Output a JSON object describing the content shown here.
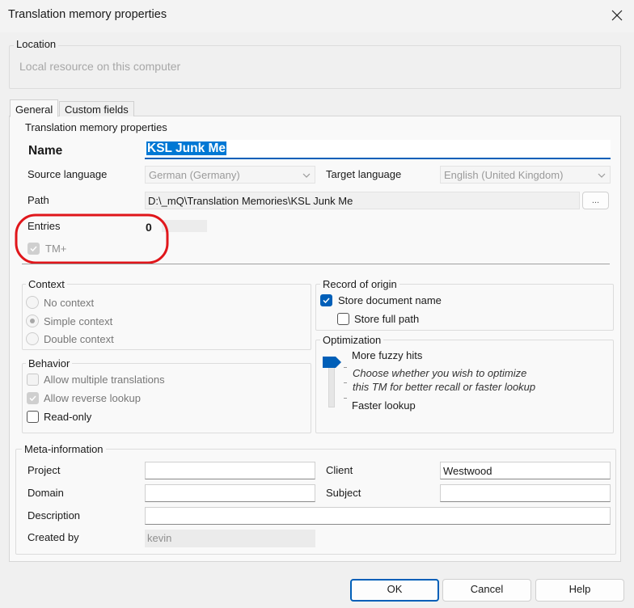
{
  "window": {
    "title": "Translation memory properties"
  },
  "location": {
    "legend": "Location",
    "value": "Local resource on this computer"
  },
  "tabs": [
    {
      "label": "General",
      "active": true
    },
    {
      "label": "Custom fields",
      "active": false
    }
  ],
  "tm_props": {
    "legend": "Translation memory properties",
    "name_label": "Name",
    "name_value": "KSL Junk Me",
    "source_label": "Source language",
    "source_value": "German (Germany)",
    "target_label": "Target language",
    "target_value": "English (United Kingdom)",
    "path_label": "Path",
    "path_value": "D:\\_mQ\\Translation Memories\\KSL Junk Me",
    "browse_label": "...",
    "entries_label": "Entries",
    "entries_value": "0",
    "tmplus_label": "TM+"
  },
  "context": {
    "legend": "Context",
    "options": [
      {
        "label": "No context",
        "selected": false
      },
      {
        "label": "Simple context",
        "selected": true
      },
      {
        "label": "Double context",
        "selected": false
      }
    ]
  },
  "behavior": {
    "legend": "Behavior",
    "allow_multiple": "Allow multiple translations",
    "allow_reverse": "Allow reverse lookup",
    "read_only": "Read-only"
  },
  "origin": {
    "legend": "Record of origin",
    "store_doc": "Store document name",
    "store_path": "Store full path"
  },
  "optimization": {
    "legend": "Optimization",
    "more_fuzzy": "More fuzzy hits",
    "desc_line1": "Choose whether you wish to optimize",
    "desc_line2": "this TM for better recall or faster lookup",
    "faster": "Faster lookup"
  },
  "meta": {
    "legend": "Meta-information",
    "project_label": "Project",
    "project_value": "",
    "client_label": "Client",
    "client_value": "Westwood",
    "domain_label": "Domain",
    "domain_value": "",
    "subject_label": "Subject",
    "subject_value": "",
    "description_label": "Description",
    "description_value": "",
    "created_by_label": "Created by",
    "created_by_value": "kevin"
  },
  "buttons": {
    "ok": "OK",
    "cancel": "Cancel",
    "help": "Help"
  },
  "colors": {
    "accent": "#005fb8",
    "highlight": "#e0161b"
  }
}
